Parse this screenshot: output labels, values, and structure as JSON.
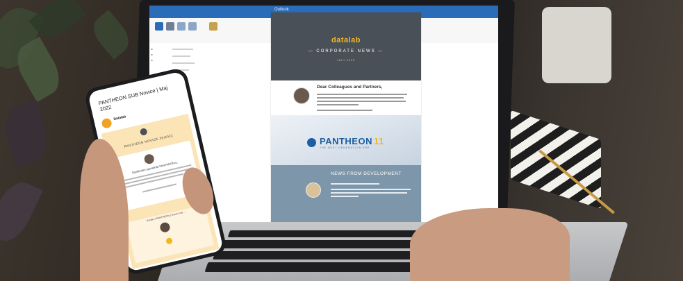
{
  "laptop": {
    "app": "Outlook",
    "newsletter": {
      "brand": "datalab",
      "subtitle": "— CORPORATE NEWS —",
      "date": "JULY 2022",
      "greeting": "Dear Colleagues and Partners,",
      "hero_brand": "PANTHEON",
      "hero_version": "11",
      "hero_tagline": "THE NEXT GENERATION ERP",
      "section_title": "NEWS FROM DEVELOPMENT"
    }
  },
  "phone": {
    "subject": "PANTHEON SUB Novice | Maj 2022",
    "sender": "Datalab",
    "title": "PANTHEON NOVICE 05/2022",
    "greeting": "Spoštovani uporabniki PANTHEON-a,",
    "section2": "Koraki v PANTHEON | Vzorci nov…"
  }
}
